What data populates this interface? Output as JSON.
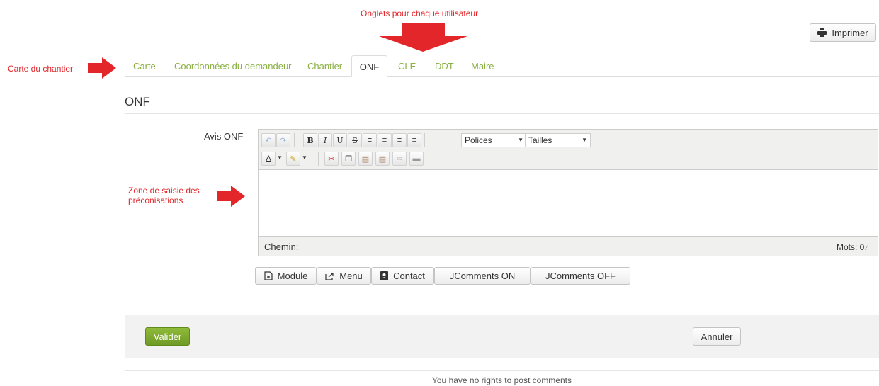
{
  "annotations": {
    "tabs_note": "Onglets pour chaque utilisateur",
    "map_note": "Carte du chantier",
    "input_note": "Zone de saisie des préconisations"
  },
  "print_button": {
    "label": "Imprimer",
    "icon": "printer-icon"
  },
  "tabs": [
    {
      "label": "Carte"
    },
    {
      "label": "Coordonnées du demandeur"
    },
    {
      "label": "Chantier"
    },
    {
      "label": "ONF"
    },
    {
      "label": "CLE"
    },
    {
      "label": "DDT"
    },
    {
      "label": "Maire"
    }
  ],
  "active_tab": "ONF",
  "section_title": "ONF",
  "field_label": "Avis ONF",
  "editor": {
    "font_select": "Polices",
    "size_select": "Tailles",
    "path_label": "Chemin:",
    "word_count": "Mots: 0",
    "content": ""
  },
  "editor_buttons": [
    {
      "label": "Module",
      "icon": "file-add-icon"
    },
    {
      "label": "Menu",
      "icon": "share-icon"
    },
    {
      "label": "Contact",
      "icon": "contact-book-icon"
    },
    {
      "label": "JComments ON"
    },
    {
      "label": "JComments OFF"
    }
  ],
  "form": {
    "submit_label": "Valider",
    "cancel_label": "Annuler"
  },
  "footer_note": "You have no rights to post comments",
  "colors": {
    "accent_green": "#8ab043",
    "submit_green": "#7ea82f",
    "annotation_red": "#e3262a"
  }
}
